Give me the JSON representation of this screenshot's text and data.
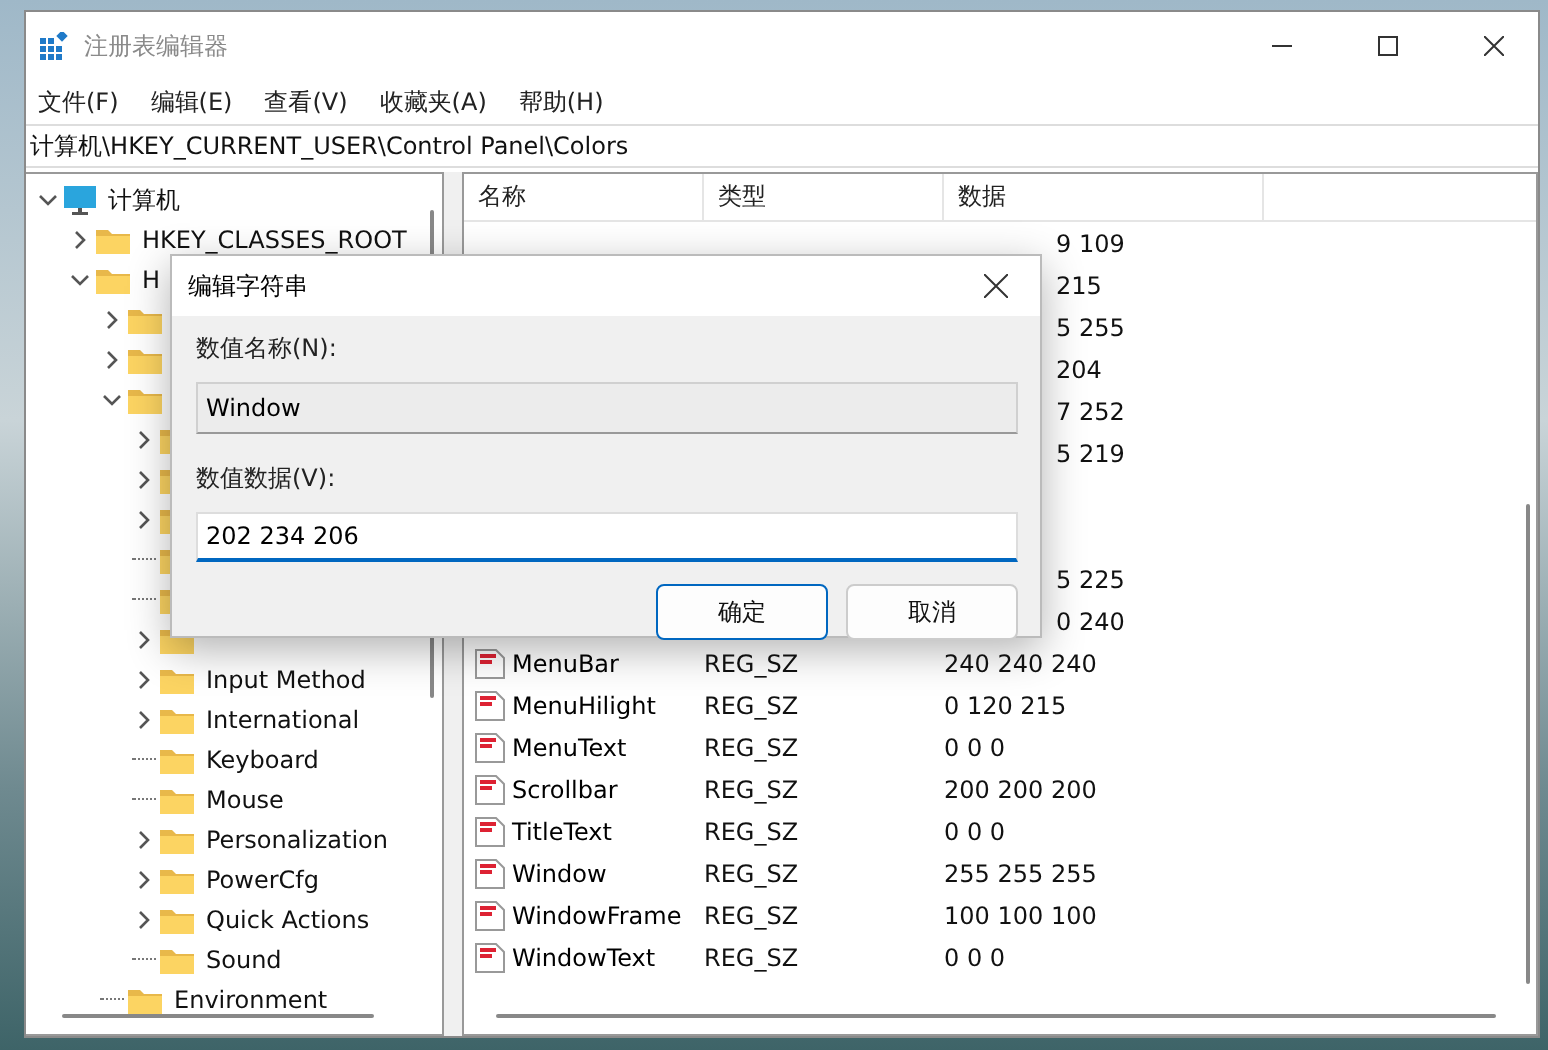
{
  "window": {
    "title": "注册表编辑器"
  },
  "menu": [
    "文件(F)",
    "编辑(E)",
    "查看(V)",
    "收藏夹(A)",
    "帮助(H)"
  ],
  "address": "计算机\\HKEY_CURRENT_USER\\Control Panel\\Colors",
  "tree": [
    {
      "label": "计算机",
      "kind": "computer",
      "expandable": true,
      "expanded": true,
      "children": [
        {
          "label": "HKEY_CLASSES_ROOT",
          "kind": "folder",
          "expandable": true,
          "expanded": false
        },
        {
          "label": "H",
          "kind": "folder",
          "expandable": true,
          "expanded": true,
          "children": [
            {
              "kind": "folder",
              "expandable": true,
              "expanded": false
            },
            {
              "kind": "folder",
              "expandable": true,
              "expanded": false
            },
            {
              "kind": "folder",
              "expandable": true,
              "expanded": true,
              "children": [
                {
                  "kind": "folder",
                  "expandable": true,
                  "expanded": false
                },
                {
                  "kind": "folder",
                  "expandable": true,
                  "expanded": false
                },
                {
                  "kind": "folder",
                  "expandable": true,
                  "expanded": false
                },
                {
                  "kind": "folder",
                  "expandable": false
                },
                {
                  "kind": "folder",
                  "expandable": false
                },
                {
                  "kind": "folder",
                  "expandable": true,
                  "expanded": false
                },
                {
                  "label": "Input Method",
                  "kind": "folder",
                  "expandable": true,
                  "expanded": false
                },
                {
                  "label": "International",
                  "kind": "folder",
                  "expandable": true,
                  "expanded": false
                },
                {
                  "label": "Keyboard",
                  "kind": "folder",
                  "expandable": false
                },
                {
                  "label": "Mouse",
                  "kind": "folder",
                  "expandable": false
                },
                {
                  "label": "Personalization",
                  "kind": "folder",
                  "expandable": true,
                  "expanded": false
                },
                {
                  "label": "PowerCfg",
                  "kind": "folder",
                  "expandable": true,
                  "expanded": false
                },
                {
                  "label": "Quick Actions",
                  "kind": "folder",
                  "expandable": true,
                  "expanded": false
                },
                {
                  "label": "Sound",
                  "kind": "folder",
                  "expandable": false
                }
              ]
            },
            {
              "label": "Environment",
              "kind": "folder",
              "expandable": false
            }
          ]
        }
      ]
    }
  ],
  "table": {
    "columns": [
      "名称",
      "类型",
      "数据"
    ],
    "rows": [
      {
        "kind": "covered",
        "data": "9 109"
      },
      {
        "kind": "covered",
        "data": "215"
      },
      {
        "kind": "covered",
        "data": "5 255"
      },
      {
        "kind": "covered",
        "data": "204"
      },
      {
        "kind": "covered",
        "data": "7 252"
      },
      {
        "kind": "covered",
        "data": "5 219"
      },
      {
        "kind": "hidden"
      },
      {
        "kind": "hidden"
      },
      {
        "kind": "covered",
        "data": "5 225"
      },
      {
        "kind": "covered",
        "data": "0 240"
      },
      {
        "kind": "full",
        "name": "MenuBar",
        "type": "REG_SZ",
        "data": "240 240 240"
      },
      {
        "kind": "full",
        "name": "MenuHilight",
        "type": "REG_SZ",
        "data": "0 120 215"
      },
      {
        "kind": "full",
        "name": "MenuText",
        "type": "REG_SZ",
        "data": "0 0 0"
      },
      {
        "kind": "full",
        "name": "Scrollbar",
        "type": "REG_SZ",
        "data": "200 200 200"
      },
      {
        "kind": "full",
        "name": "TitleText",
        "type": "REG_SZ",
        "data": "0 0 0"
      },
      {
        "kind": "full",
        "name": "Window",
        "type": "REG_SZ",
        "data": "255 255 255"
      },
      {
        "kind": "full",
        "name": "WindowFrame",
        "type": "REG_SZ",
        "data": "100 100 100"
      },
      {
        "kind": "full",
        "name": "WindowText",
        "type": "REG_SZ",
        "data": "0 0 0"
      }
    ]
  },
  "dialog": {
    "title": "编辑字符串",
    "name_label": "数值名称(N):",
    "name_value": "Window",
    "data_label": "数值数据(V):",
    "data_value": "202 234 206",
    "buttons": [
      {
        "label": "确定",
        "default": true
      },
      {
        "label": "取消",
        "default": false
      }
    ]
  }
}
